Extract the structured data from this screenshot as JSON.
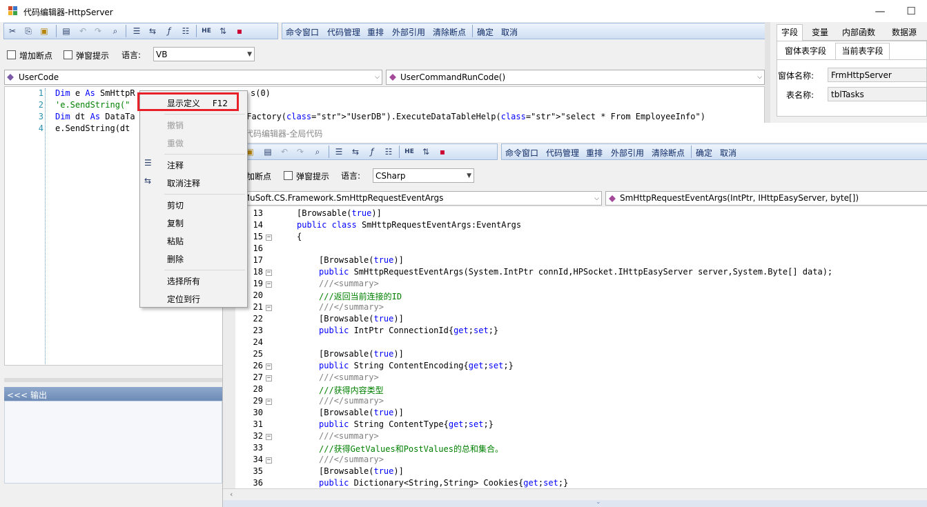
{
  "main_window": {
    "title": "代码编辑器-HttpServer",
    "window_controls": {
      "minimize": "—",
      "maximize": "☐"
    },
    "toolbar_commands": [
      "命令窗口",
      "代码管理",
      "重排",
      "外部引用",
      "清除断点",
      "确定",
      "取消"
    ],
    "options": {
      "add_breakpoint": "增加断点",
      "popup_hint": "弹窗提示",
      "language_label": "语言:",
      "language_value": "VB"
    },
    "class_combo": "UserCode",
    "method_combo": "UserCommandRunCode()",
    "code_lines": [
      {
        "num": "1",
        "pre": "Dim e As SmHttpR",
        "tail": "s(0)"
      },
      {
        "num": "2",
        "pre": "'e.SendString(\"",
        "tail": ""
      },
      {
        "num": "3",
        "pre": "Dim dt As DataTa",
        "tail": "aFactory(\"UserDB\").ExecuteDataTableHelp(\"select * From EmployeeInfo\")"
      },
      {
        "num": "4",
        "pre": "e.SendString(dt",
        "tail": ""
      }
    ],
    "output_header": "<<< 输出",
    "right_panel": {
      "tabs": [
        "字段",
        "变量",
        "内部函数",
        "数据源"
      ],
      "sub_tabs": [
        "窗体表字段",
        "当前表字段"
      ],
      "form_name_label": "窗体名称:",
      "form_name_value": "FrmHttpServer",
      "table_name_label": "表名称:",
      "table_name_value": "tblTasks"
    }
  },
  "context_menu": {
    "items": [
      {
        "label": "显示定义",
        "shortcut": "F12",
        "enabled": true
      },
      {
        "label": "撤销",
        "enabled": false
      },
      {
        "label": "重做",
        "enabled": false
      },
      {
        "label": "注释",
        "enabled": true
      },
      {
        "label": "取消注释",
        "enabled": true
      },
      {
        "label": "剪切",
        "enabled": true
      },
      {
        "label": "复制",
        "enabled": true
      },
      {
        "label": "粘贴",
        "enabled": true
      },
      {
        "label": "删除",
        "enabled": true
      },
      {
        "label": "选择所有",
        "enabled": true
      },
      {
        "label": "定位到行",
        "enabled": true
      }
    ]
  },
  "global_window": {
    "title": "代码编辑器-全局代码",
    "toolbar_commands": [
      "命令窗口",
      "代码管理",
      "重排",
      "外部引用",
      "清除断点",
      "确定",
      "取消"
    ],
    "options": {
      "add_breakpoint": "加断点",
      "popup_hint": "弹窗提示",
      "language_label": "语言:",
      "language_value": "CSharp"
    },
    "class_combo": "nMuSoft.CS.Framework.SmHttpRequestEventArgs",
    "method_combo": "SmHttpRequestEventArgs(IntPtr, IHttpEasyServer, byte[])",
    "code_lines": [
      {
        "num": "13",
        "text": "[Browsable(true)]"
      },
      {
        "num": "14",
        "text": "public class SmHttpRequestEventArgs:EventArgs"
      },
      {
        "num": "15",
        "text": "{"
      },
      {
        "num": "16",
        "text": ""
      },
      {
        "num": "17",
        "text": "[Browsable(true)]"
      },
      {
        "num": "18",
        "text": "public SmHttpRequestEventArgs(System.IntPtr connId,HPSocket.IHttpEasyServer server,System.Byte[] data);"
      },
      {
        "num": "19",
        "text": "///<summary>"
      },
      {
        "num": "20",
        "text": "///返回当前连接的ID"
      },
      {
        "num": "21",
        "text": "///</summary>"
      },
      {
        "num": "22",
        "text": "[Browsable(true)]"
      },
      {
        "num": "23",
        "text": "public IntPtr ConnectionId{get;set;}"
      },
      {
        "num": "24",
        "text": ""
      },
      {
        "num": "25",
        "text": "[Browsable(true)]"
      },
      {
        "num": "26",
        "text": "public String ContentEncoding{get;set;}"
      },
      {
        "num": "27",
        "text": "///<summary>"
      },
      {
        "num": "28",
        "text": "///获得内容类型"
      },
      {
        "num": "29",
        "text": "///</summary>"
      },
      {
        "num": "30",
        "text": "[Browsable(true)]"
      },
      {
        "num": "31",
        "text": "public String ContentType{get;set;}"
      },
      {
        "num": "32",
        "text": "///<summary>"
      },
      {
        "num": "33",
        "text": "///获得GetValues和PostValues的总和集合。"
      },
      {
        "num": "34",
        "text": "///</summary>"
      },
      {
        "num": "35",
        "text": "[Browsable(true)]"
      },
      {
        "num": "36",
        "text": "public Dictionary<String,String> Cookies{get;set;}"
      }
    ]
  },
  "colors": {
    "keyword": "#0000ff",
    "string": "#a31515",
    "comment": "#008000",
    "line_number": "#2b91af",
    "highlight_box": "#e8202a",
    "toolbar_text": "#0e2a66"
  }
}
